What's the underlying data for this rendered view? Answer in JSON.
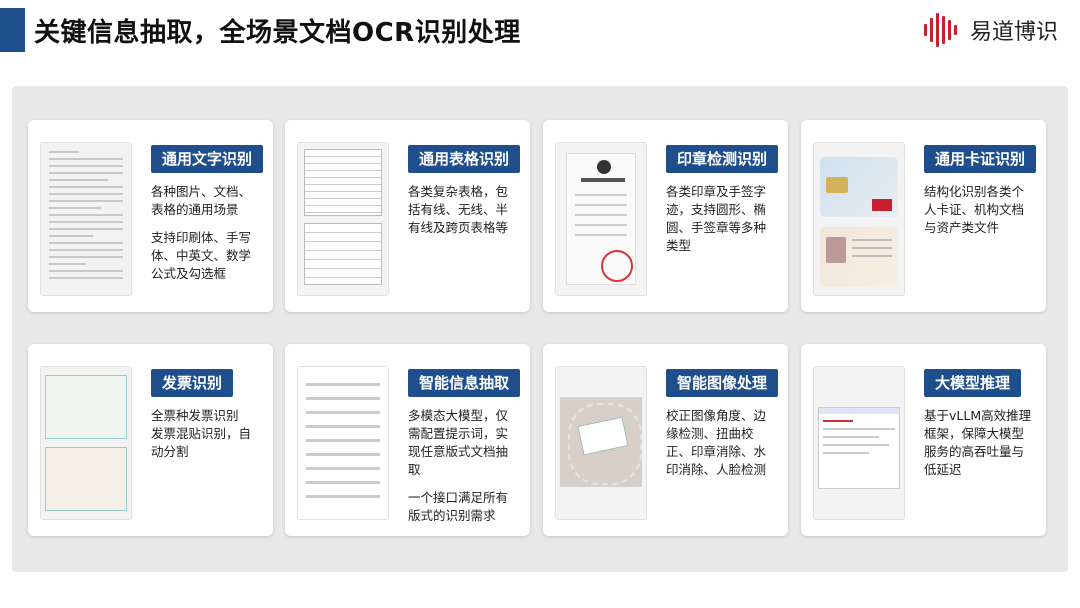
{
  "header": {
    "title": "关键信息抽取，全场景文档OCR识别处理",
    "logo_text": "易道博识",
    "accent_color": "#1f4e8c",
    "logo_color": "#c8202f"
  },
  "cards": [
    {
      "tag": "通用文字识别",
      "desc": [
        "各种图片、文档、表格的通用场景",
        "支持印刷体、手写体、中英文、数学公式及勾选框"
      ]
    },
    {
      "tag": "通用表格识别",
      "desc": [
        "各类复杂表格，包括有线、无线、半有线及跨页表格等"
      ]
    },
    {
      "tag": "印章检测识别",
      "desc": [
        "各类印章及手签字迹，支持圆形、椭圆、手签章等多种类型"
      ]
    },
    {
      "tag": "通用卡证识别",
      "desc": [
        "结构化识别各类个人卡证、机构文档与资产类文件"
      ]
    },
    {
      "tag": "发票识别",
      "desc": [
        "全票种发票识别",
        "发票混贴识别，自动分割"
      ]
    },
    {
      "tag": "智能信息抽取",
      "desc": [
        "多模态大模型，仅需配置提示词，实现任意版式文档抽取",
        "一个接口满足所有版式的识别需求"
      ]
    },
    {
      "tag": "智能图像处理",
      "desc": [
        "校正图像角度、边缘检测、扭曲校正、印章消除、水印消除、人脸检测"
      ]
    },
    {
      "tag": "大模型推理",
      "desc": [
        "基于vLLM高效推理框架，保障大模型服务的高吞吐量与低延迟"
      ]
    }
  ]
}
